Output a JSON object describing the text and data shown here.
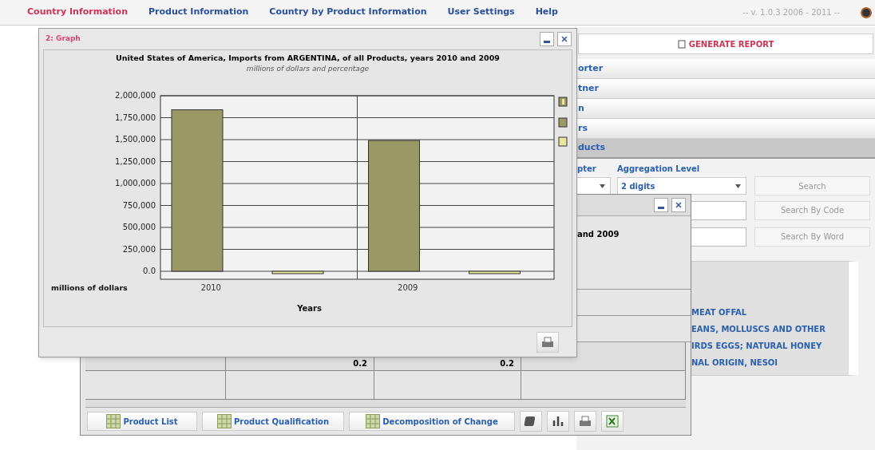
{
  "nav": {
    "tabs": [
      {
        "label": "Country Information",
        "selected": true
      },
      {
        "label": "Product Information",
        "selected": false
      },
      {
        "label": "Country by Product Information",
        "selected": false
      },
      {
        "label": "User Settings",
        "selected": false
      },
      {
        "label": "Help",
        "selected": false
      }
    ],
    "version": "-- v. 1.0.3 2006 - 2011 --"
  },
  "side_panel": {
    "generate_button": "GENERATE REPORT",
    "accordion": [
      {
        "label": "orter",
        "selected": false
      },
      {
        "label": "tner",
        "selected": false
      },
      {
        "label": "n",
        "selected": false
      },
      {
        "label": "rs",
        "selected": false
      },
      {
        "label": "ducts",
        "selected": true
      }
    ],
    "labels": [
      "pter",
      "Aggregation Level"
    ],
    "aggregation_select": "2 digits",
    "search_button": "Search",
    "search_code_button": "Search By Code",
    "search_word_button": "Search By Word",
    "results": [
      "MEAT OFFAL",
      "EANS, MOLLUSCS AND OTHER",
      "IRDS EGGS; NATURAL HONEY",
      "NAL ORIGIN, NESOI"
    ]
  },
  "table_window": {
    "heading": "and 2009",
    "rows": [
      {
        "cells": [
          "",
          "0.2",
          "0.2",
          ""
        ]
      },
      {
        "cells": [
          "",
          "",
          "",
          ""
        ]
      }
    ],
    "toolbar": [
      "Product List",
      "Product Qualification",
      "Decomposition of Change"
    ]
  },
  "graph_window": {
    "title": "2: Graph",
    "heading": "United States of America, Imports from ARGENTINA, of all Products, years 2010 and 2009",
    "subheading": "millions of dollars and percentage",
    "chart_data": {
      "type": "bar",
      "grid": true,
      "ylabel": "millions of dollars",
      "xlabel": "Years",
      "categories": [
        "2010",
        "2009"
      ],
      "series": [
        {
          "color": "#999966",
          "values": [
            1840000,
            1490000
          ]
        },
        {
          "color": "#e6e6a0",
          "values": [
            0,
            0
          ]
        }
      ],
      "ylim": [
        0,
        2000000
      ],
      "yticks": [
        {
          "value": 0,
          "label": "0.0"
        },
        {
          "value": 250000,
          "label": "250,000"
        },
        {
          "value": 500000,
          "label": "500,000"
        },
        {
          "value": 750000,
          "label": "750,000"
        },
        {
          "value": 1000000,
          "label": "1,000,000"
        },
        {
          "value": 1250000,
          "label": "1,250,000"
        },
        {
          "value": 1500000,
          "label": "1,500,000"
        },
        {
          "value": 1750000,
          "label": "1,750,000"
        },
        {
          "value": 2000000,
          "label": "2,000,000"
        }
      ]
    }
  }
}
